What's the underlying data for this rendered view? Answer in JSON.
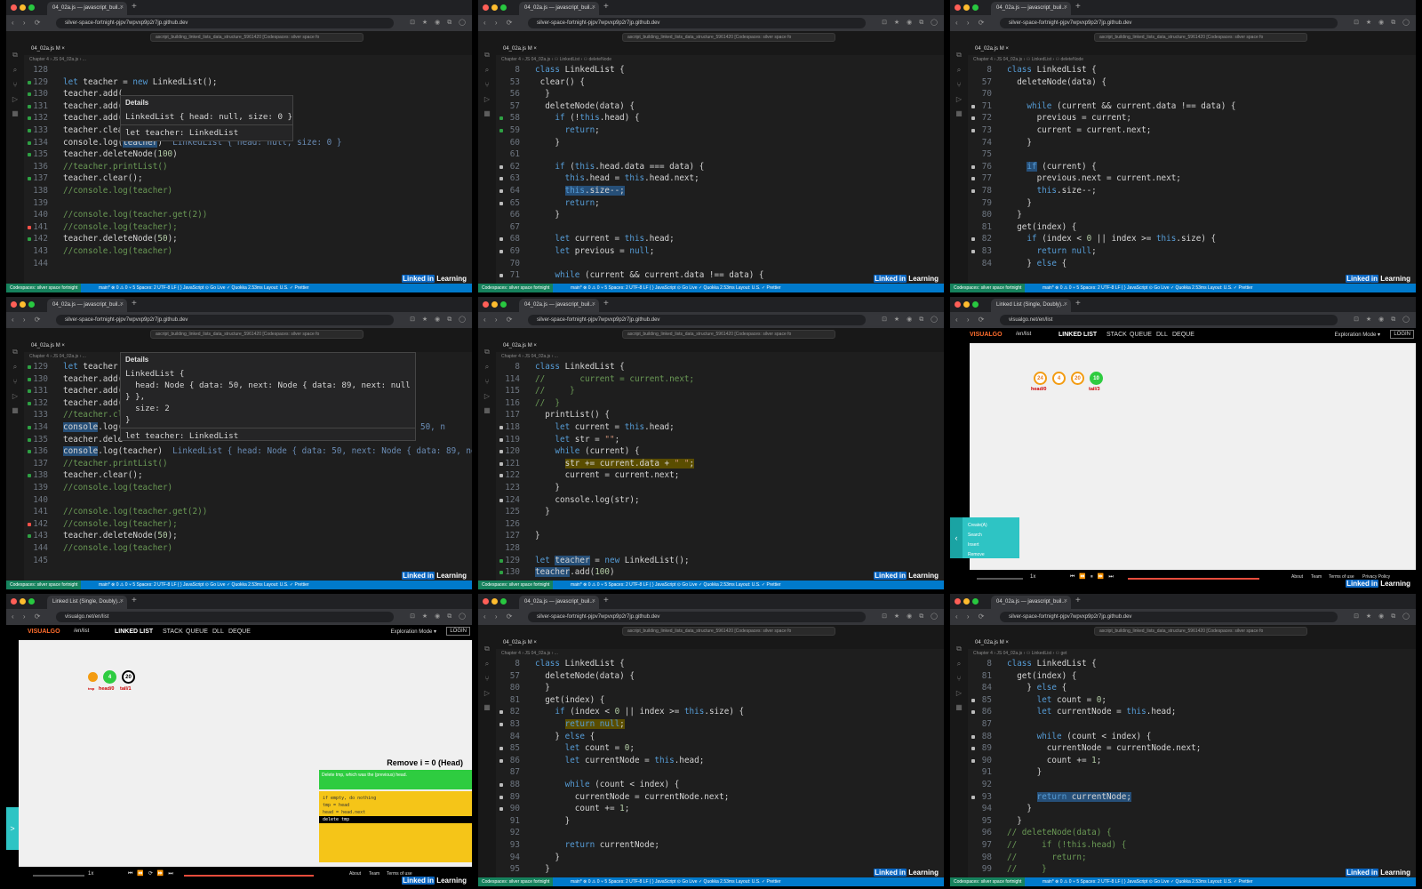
{
  "browser": {
    "tab_editor": "04_02a.js — javascript_buil...",
    "tab_visualgo": "Linked List (Single, Doubly)...",
    "tab_close": "×",
    "new_tab": "+",
    "url_codespace": "silver-space-fortnight-pjpv7wpvxp9p2r7jp.github.dev",
    "url_visualgo": "visualgo.net/en/list",
    "nav_icons": "‹ › ⟳",
    "right_icons": "⊡ ★ ◉ ⧉ ◯"
  },
  "vscode": {
    "command_center": "ascript_building_linked_lists_data_structure_5961420 [Codespaces: silver space fo",
    "editor_tab": "04_02a.js M  ×",
    "activity_icons": [
      "⧉",
      "⌕",
      "⑂",
      "▷",
      "▦",
      "◎",
      "◷"
    ],
    "status_remote": "Codespaces: silver space fortnight",
    "status_text": "main*  ⊗ 0 ⚠ 0  ⑂ 5   Spaces: 2   UTF-8   LF   { } JavaScript   ⊙ Go Live   ✓ Quokka 2.53ms   Layout: U.S.   ✓ Prettier",
    "linkedin_pre": "Linked",
    "linkedin_in": "in",
    "linkedin_post": " Learning"
  },
  "tile1": {
    "breadcrumb": "Chapter 4 › JS 04_02a.js › ...",
    "hover": {
      "title": "Details",
      "value": "LinkedList { head: null, size: 0 }",
      "sig": "let teacher: LinkedList"
    },
    "inlay": "LinkedList { head: null, size: 0 }"
  },
  "tile2": {
    "breadcrumb": "Chapter 4 › JS 04_02a.js › ⚇ LinkedList › ⚇ deleteNode"
  },
  "tile3": {
    "breadcrumb": "Chapter 4 › JS 04_02a.js › ⚇ LinkedList › ⚇ deleteNode"
  },
  "tile4": {
    "breadcrumb": "Chapter 4 › JS 04_02a.js › ...",
    "hover": {
      "title": "Details",
      "line1": "LinkedList {",
      "line2": "  head: Node { data: 50, next: Node { data: 89, next: null",
      "line3": "} },",
      "line4": "  size: 2",
      "line5": "}",
      "sig": "let teacher: LinkedList"
    },
    "inlay": "LinkedList { head: Node { data: 50, next: Node { data: 89, ne",
    "inlay_top": "ata: 50, n"
  },
  "tile5": {
    "breadcrumb": "Chapter 4 › JS 04_02a.js › ..."
  },
  "tile7": {
    "breadcrumb": "Chapter 4 › JS 04_02a.js › ..."
  },
  "tile9": {
    "breadcrumb": "Chapter 4 › JS 04_02a.js › ⚇ LinkedList › ⚇ get"
  },
  "visualgo": {
    "logo": "VISUALGO",
    "lang": "/en/list",
    "menu": [
      "LINKED LIST",
      "STACK",
      "QUEUE",
      "DLL",
      "DEQUE"
    ],
    "mode": "Exploration Mode ▾",
    "login": "LOGIN",
    "panel_items": [
      "Create(A)",
      "Search",
      "Insert",
      "Remove"
    ],
    "footer_links": [
      "About",
      "Team",
      "Terms of use",
      "Privacy Policy"
    ],
    "speed": "1x",
    "collapse": "‹",
    "expand": ">",
    "list_a": {
      "nodes": [
        "24",
        "4",
        "20",
        "10"
      ],
      "head": "head/0",
      "tail": "tail/3"
    },
    "list_b": {
      "nodes": [
        "24",
        "4",
        "20"
      ],
      "tmp": "tmp",
      "head": "head/0",
      "tail": "tail/1"
    },
    "remove_title": "Remove i = 0 (Head)",
    "remove_desc": "Delete tmp, which was the (previous) head.",
    "pseudo": [
      "if empty, do nothing",
      "tmp = head",
      "head = head.next",
      "delete tmp"
    ]
  }
}
